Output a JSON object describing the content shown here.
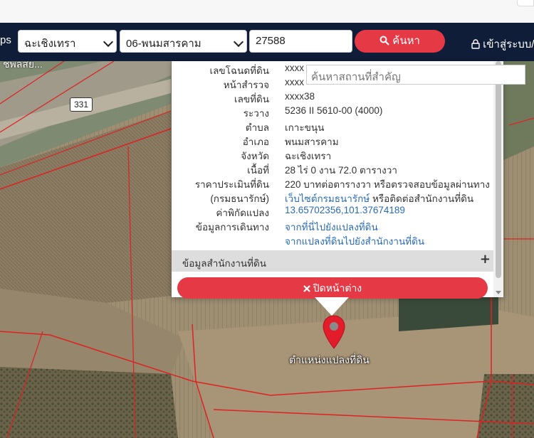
{
  "navbar": {
    "brand_fragment": "ps",
    "province_select": "ฉะเชิงเทรา",
    "office_select": "06-พนมสารคาม",
    "deed_number": "27588",
    "search_label": "ค้นหา",
    "login_label": "เข้าสู่ระบบ/ส"
  },
  "map": {
    "road_label": "ชพลสย...",
    "highway_shield": "331",
    "place_search_placeholder": "ค้นหาสถานที่สำคัญ",
    "marker_label": "ตำแหน่งแปลงที่ดิน"
  },
  "popup": {
    "rows": [
      {
        "label": "เลขโฉนดที่ดิน",
        "value": "xxxx"
      },
      {
        "label": "หน้าสำรวจ",
        "value": "xxxx"
      },
      {
        "label": "เลขที่ดิน",
        "value": "xxxx38"
      },
      {
        "label": "ระวาง",
        "value": "5236 II 5610-00 (4000)"
      },
      {
        "label": "ตำบล",
        "value": "เกาะขนุน"
      },
      {
        "label": "อำเภอ",
        "value": "พนมสารคาม"
      },
      {
        "label": "จังหวัด",
        "value": "ฉะเชิงเทรา"
      },
      {
        "label": "เนื้อที่",
        "value": "28 ไร่ 0 งาน 72.0 ตารางวา"
      },
      {
        "label": "ราคาประเมินที่ดิน",
        "value": "220 บาทต่อตารางวา หรือตรวจสอบข้อมูลผ่านทาง"
      },
      {
        "label": "(กรมธนารักษ์)",
        "value_link": "เว็บไซต์กรมธนารักษ์",
        "value": " หรือติดต่อสำนักงานที่ดิน"
      },
      {
        "label": "ค่าพิกัดแปลง",
        "value_link": "13.65702356,101.37674189"
      },
      {
        "label": "ข้อมูลการเดินทาง",
        "value_link": "จากที่นี่ไปยังแปลงที่ดิน"
      },
      {
        "label": "",
        "value_link": "จากแปลงที่ดินไปยังสำนักงานที่ดิน"
      }
    ],
    "accordion_title": "ข้อมูลสำนักงานที่ดิน",
    "accordion_plus": "+",
    "close_label": "ปิดหน้าต่าง"
  },
  "colors": {
    "navbar": "#0f1d38",
    "accent": "#e63946",
    "link": "#2a6bb8"
  }
}
